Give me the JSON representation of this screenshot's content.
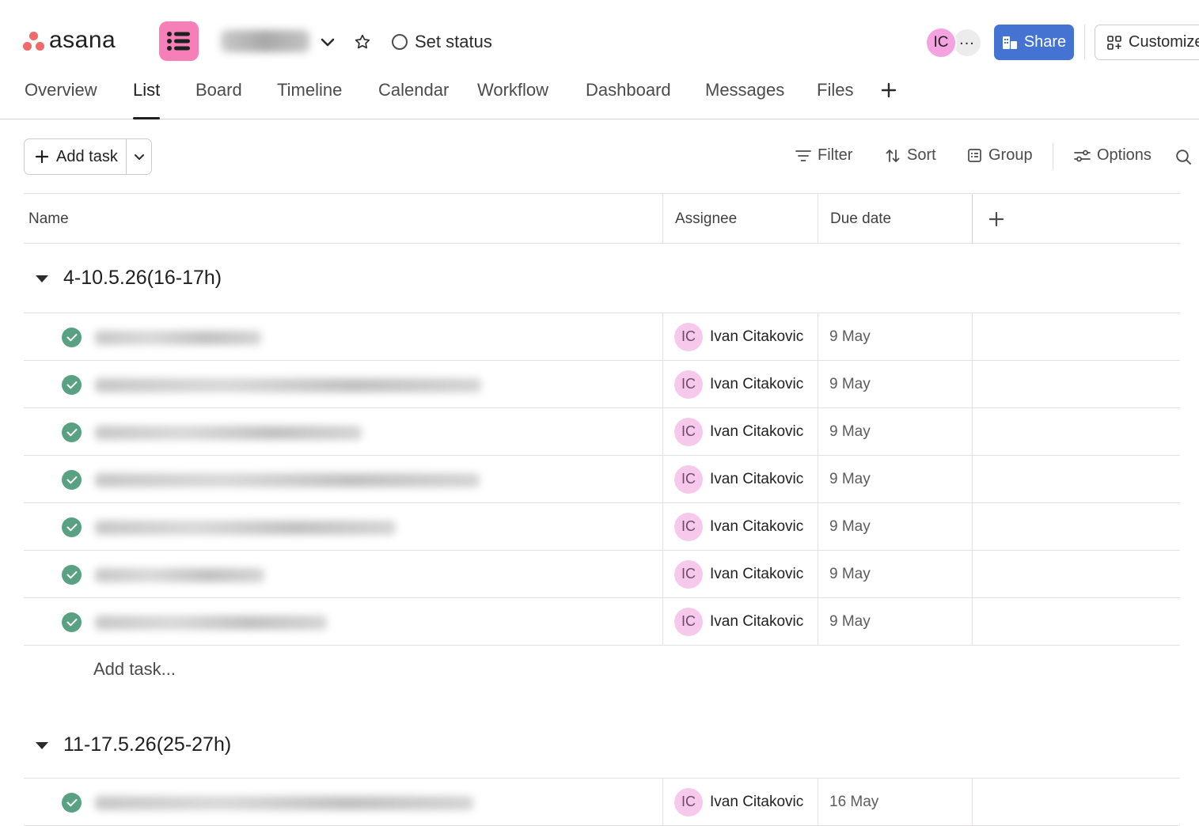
{
  "brand": {
    "name": "asana"
  },
  "header": {
    "set_status": "Set status",
    "avatar_initials": "IC",
    "share_label": "Share",
    "customize_label": "Customize"
  },
  "tabs": [
    {
      "label": "Overview"
    },
    {
      "label": "List"
    },
    {
      "label": "Board"
    },
    {
      "label": "Timeline"
    },
    {
      "label": "Calendar"
    },
    {
      "label": "Workflow"
    },
    {
      "label": "Dashboard"
    },
    {
      "label": "Messages"
    },
    {
      "label": "Files"
    }
  ],
  "toolbar": {
    "add_task": "Add task",
    "filter": "Filter",
    "sort": "Sort",
    "group": "Group",
    "options": "Options"
  },
  "columns": {
    "name": "Name",
    "assignee": "Assignee",
    "due": "Due date"
  },
  "sections": [
    {
      "title": "4-10.5.26(16-17h)",
      "add_task_text": "Add task...",
      "tasks": [
        {
          "assignee_initials": "IC",
          "assignee": "Ivan Citakovic",
          "due": "9 May"
        },
        {
          "assignee_initials": "IC",
          "assignee": "Ivan Citakovic",
          "due": "9 May"
        },
        {
          "assignee_initials": "IC",
          "assignee": "Ivan Citakovic",
          "due": "9 May"
        },
        {
          "assignee_initials": "IC",
          "assignee": "Ivan Citakovic",
          "due": "9 May"
        },
        {
          "assignee_initials": "IC",
          "assignee": "Ivan Citakovic",
          "due": "9 May"
        },
        {
          "assignee_initials": "IC",
          "assignee": "Ivan Citakovic",
          "due": "9 May"
        },
        {
          "assignee_initials": "IC",
          "assignee": "Ivan Citakovic",
          "due": "9 May"
        }
      ]
    },
    {
      "title": "11-17.5.26(25-27h)",
      "tasks": [
        {
          "assignee_initials": "IC",
          "assignee": "Ivan Citakovic",
          "due": "16 May"
        }
      ]
    }
  ],
  "colors": {
    "brand_coral": "#f06a6a",
    "project_icon": "#f77fb7",
    "share_button": "#4573d2",
    "complete_check": "#58a182",
    "avatar": "#f4a3e0"
  }
}
